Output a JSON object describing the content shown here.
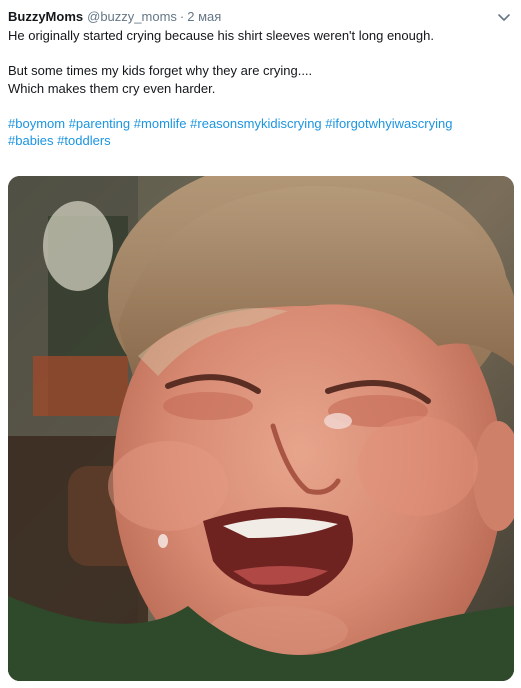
{
  "tweet": {
    "author": {
      "display_name": "BuzzyMoms",
      "handle": "@buzzy_moms",
      "separator": "·",
      "timestamp": "2 мая"
    },
    "text": {
      "line1": "He originally started crying because his shirt sleeves weren't long enough.",
      "line2": "But some times my kids forget why they are crying....",
      "line3": "Which makes them cry even harder."
    },
    "hashtags": [
      "#boymom",
      "#parenting",
      "#momlife",
      "#reasonsmykidiscrying",
      "#iforgotwhyiwascrying",
      "#babies",
      "#toddlers"
    ],
    "menu_icon": "chevron-down-icon",
    "link_color": "#1b95e0",
    "secondary_color": "#657786"
  }
}
